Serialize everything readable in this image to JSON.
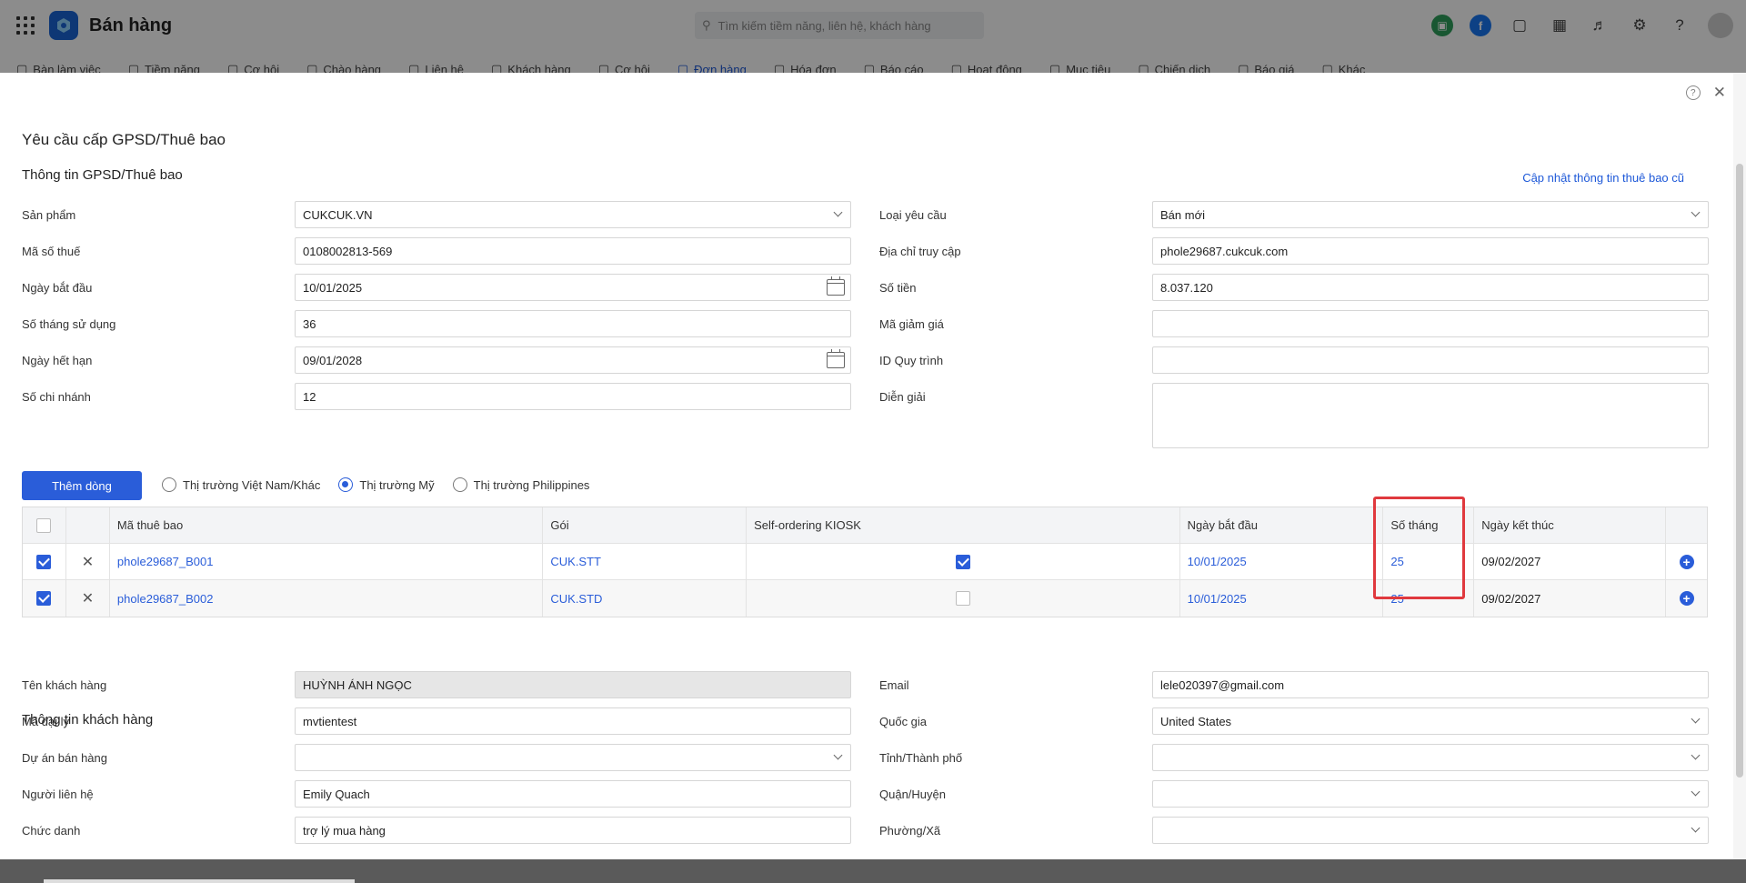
{
  "app": {
    "title": "Bán hàng",
    "search_placeholder": "Tìm kiếm tiềm năng, liên hệ, khách hàng"
  },
  "nav": {
    "items": [
      "Bàn làm việc",
      "Tiềm năng",
      "Cơ hội",
      "Chào hàng",
      "Liên hệ",
      "Khách hàng",
      "Cơ hội",
      "Đơn hàng",
      "Hóa đơn",
      "Báo cáo",
      "Hoạt động",
      "Mục tiêu",
      "Chiến dịch",
      "Báo giá",
      "Khác"
    ],
    "active_index": 7
  },
  "modal": {
    "title": "Yêu cầu cấp GPSD/Thuê bao",
    "section_license": "Thông tin GPSD/Thuê bao",
    "update_link": "Cập nhật thông tin thuê bao cũ",
    "left_fields": [
      {
        "label": "Sản phẩm",
        "value": "CUKCUK.VN",
        "type": "select"
      },
      {
        "label": "Mã số thuế",
        "value": "0108002813-569",
        "type": "text"
      },
      {
        "label": "Ngày bắt đầu",
        "value": "10/01/2025",
        "type": "date"
      },
      {
        "label": "Số tháng sử dụng",
        "value": "36",
        "type": "text"
      },
      {
        "label": "Ngày hết hạn",
        "value": "09/01/2028",
        "type": "date"
      },
      {
        "label": "Số chi nhánh",
        "value": "12",
        "type": "text"
      }
    ],
    "right_fields": [
      {
        "label": "Loại yêu cầu",
        "value": "Bán mới",
        "type": "select"
      },
      {
        "label": "Địa chỉ truy cập",
        "value": "phole29687.cukcuk.com",
        "type": "text"
      },
      {
        "label": "Số tiền",
        "value": "8.037.120",
        "type": "text"
      },
      {
        "label": "Mã giảm giá",
        "value": "",
        "type": "text"
      },
      {
        "label": "ID Quy trình",
        "value": "",
        "type": "text"
      },
      {
        "label": "Diễn giải",
        "value": "",
        "type": "textarea"
      }
    ],
    "add_row_label": "Thêm dòng",
    "markets": [
      {
        "label": "Thị trường Việt Nam/Khác",
        "selected": false
      },
      {
        "label": "Thị trường Mỹ",
        "selected": true
      },
      {
        "label": "Thị trường Philippines",
        "selected": false
      }
    ],
    "table": {
      "headers": [
        "Mã thuê bao",
        "Gói",
        "Self-ordering KIOSK",
        "Ngày bắt đầu",
        "Số tháng",
        "Ngày kết thúc"
      ],
      "rows": [
        {
          "code": "phole29687_B001",
          "package": "CUK.STT",
          "kiosk": true,
          "start": "10/01/2025",
          "months": "25",
          "end": "09/02/2027",
          "checked": true
        },
        {
          "code": "phole29687_B002",
          "package": "CUK.STD",
          "kiosk": false,
          "start": "10/01/2025",
          "months": "25",
          "end": "09/02/2027",
          "checked": true
        }
      ]
    },
    "section_customer": "Thông tin khách hàng",
    "cust_left": [
      {
        "label": "Tên khách hàng",
        "value": "HUỲNH ÁNH NGỌC",
        "type": "readonly"
      },
      {
        "label": "Mã đại lý",
        "value": "mvtientest",
        "type": "text"
      },
      {
        "label": "Dự án bán hàng",
        "value": "",
        "type": "select"
      },
      {
        "label": "Người liên hệ",
        "value": "Emily Quach",
        "type": "text"
      },
      {
        "label": "Chức danh",
        "value": "trợ lý mua hàng",
        "type": "text"
      }
    ],
    "cust_right": [
      {
        "label": "Email",
        "value": "lele020397@gmail.com",
        "type": "text"
      },
      {
        "label": "Quốc gia",
        "value": "United States",
        "type": "select"
      },
      {
        "label": "Tỉnh/Thành phố",
        "value": "",
        "type": "select"
      },
      {
        "label": "Quận/Huyện",
        "value": "",
        "type": "select"
      },
      {
        "label": "Phường/Xã",
        "value": "",
        "type": "select"
      }
    ]
  },
  "colors": {
    "primary": "#2a5dd9",
    "highlight": "#e0393e"
  }
}
